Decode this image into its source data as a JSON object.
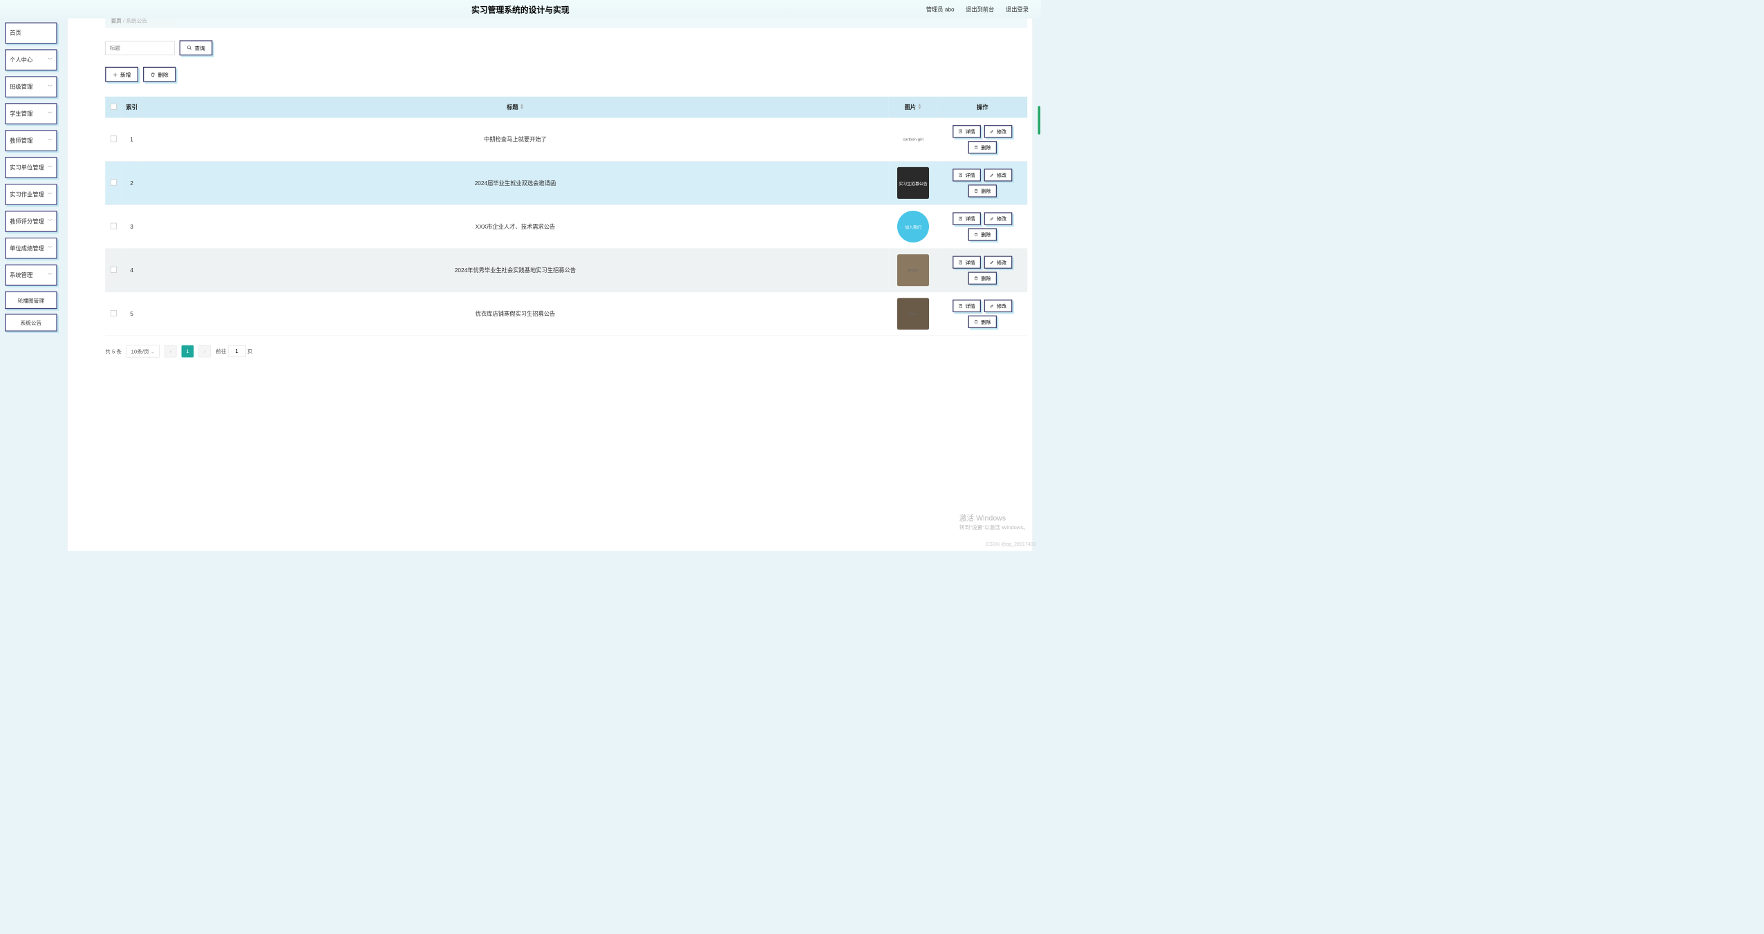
{
  "header": {
    "title": "实习管理系统的设计与实现",
    "user_label": "管理员 abo",
    "to_front": "退出到前台",
    "logout": "退出登录"
  },
  "sidebar": {
    "items": [
      {
        "label": "首页",
        "expandable": false
      },
      {
        "label": "个人中心",
        "expandable": true
      },
      {
        "label": "班级管理",
        "expandable": true
      },
      {
        "label": "学生管理",
        "expandable": true
      },
      {
        "label": "教师管理",
        "expandable": true
      },
      {
        "label": "实习单位管理",
        "expandable": true
      },
      {
        "label": "实习作业管理",
        "expandable": true
      },
      {
        "label": "教师评分管理",
        "expandable": true
      },
      {
        "label": "单位成绩管理",
        "expandable": true
      },
      {
        "label": "系统管理",
        "expandable": true
      }
    ],
    "sub_items": [
      "轮播图管理",
      "系统公告"
    ]
  },
  "breadcrumb": {
    "home": "首页",
    "sep": "/",
    "current": "系统公告"
  },
  "toolbar": {
    "search_placeholder": "标题",
    "query": "查询",
    "add": "新增",
    "delete": "删除"
  },
  "table": {
    "headers": {
      "index": "索引",
      "title": "标题",
      "image": "图片",
      "ops": "操作"
    },
    "ops": {
      "detail": "详情",
      "edit": "修改",
      "delete": "删除"
    },
    "rows": [
      {
        "idx": "1",
        "title": "中期检查马上就要开始了",
        "img": "cartoon-girl"
      },
      {
        "idx": "2",
        "title": "2024届毕业生就业双选会邀请函",
        "img": "实习生招募公告"
      },
      {
        "idx": "3",
        "title": "XXX市企业人才、技术需求公告",
        "img": "加入我们"
      },
      {
        "idx": "4",
        "title": "2024年优秀毕业生社会实践基地实习生招募公告",
        "img": "photo"
      },
      {
        "idx": "5",
        "title": "优衣库店铺寒假实习生招募公告",
        "img": "store"
      }
    ]
  },
  "pager": {
    "total_label": "共 5 条",
    "page_size": "10条/页",
    "current": "1",
    "goto_prefix": "前往",
    "goto_value": "1",
    "goto_suffix": "页"
  },
  "watermark": {
    "line1": "激活 Windows",
    "line2": "转到\"设置\"以激活 Windows。"
  },
  "csdn": "CSDN @qq_28917403"
}
